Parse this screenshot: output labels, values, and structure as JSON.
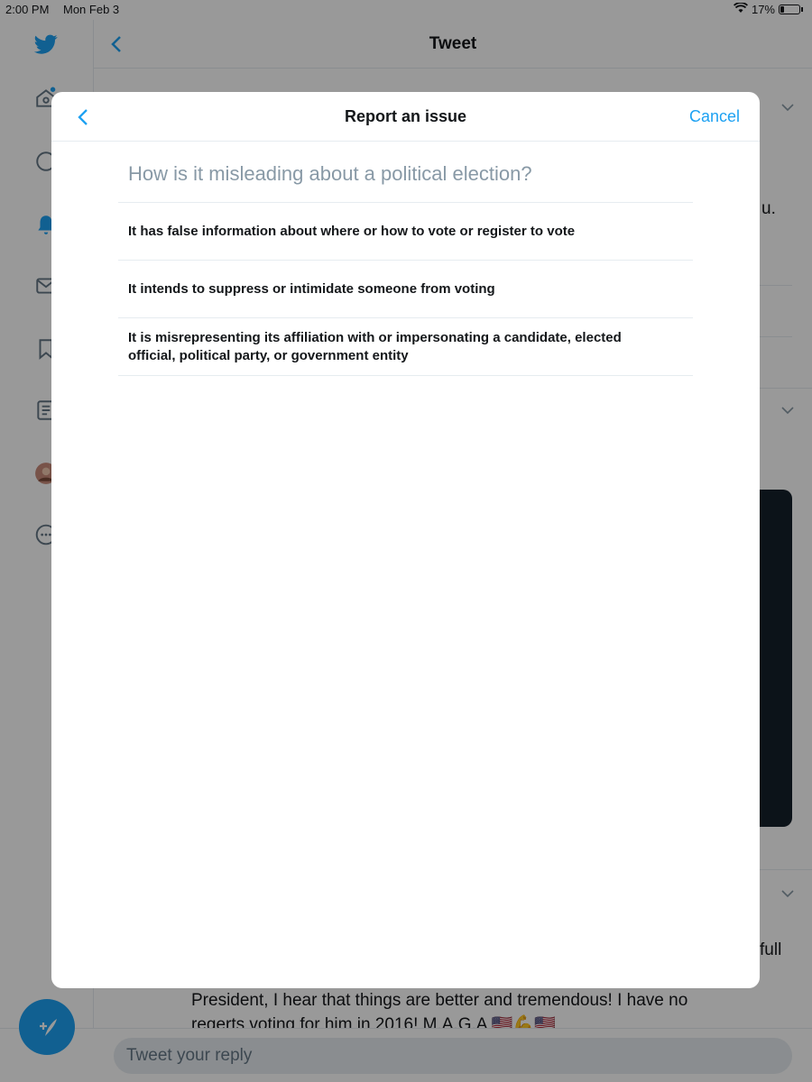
{
  "status_bar": {
    "time": "2:00 PM",
    "date": "Mon Feb 3",
    "battery": "17%"
  },
  "header": {
    "title": "Tweet"
  },
  "background_text": {
    "partial_right_1": "u.",
    "partial_right_2": "full",
    "reply_line_1": "President, I hear that things are better and tremendous! I have no",
    "reply_line_2": "regerts voting for him in 2016! M.A.G.A 🇺🇸💪🇺🇸"
  },
  "reply": {
    "placeholder": "Tweet your reply"
  },
  "modal": {
    "title": "Report an issue",
    "cancel_label": "Cancel",
    "question": "How is it misleading about a political election?",
    "options": [
      {
        "label": "It has false information about where or how to vote or register to vote"
      },
      {
        "label": "It intends to suppress or intimidate someone from voting"
      },
      {
        "label": "It is misrepresenting its affiliation with or impersonating a candidate, elected official, political party, or government entity"
      }
    ]
  },
  "colors": {
    "accent": "#1da1f2",
    "text": "#14171a",
    "muted": "#8899a6"
  }
}
